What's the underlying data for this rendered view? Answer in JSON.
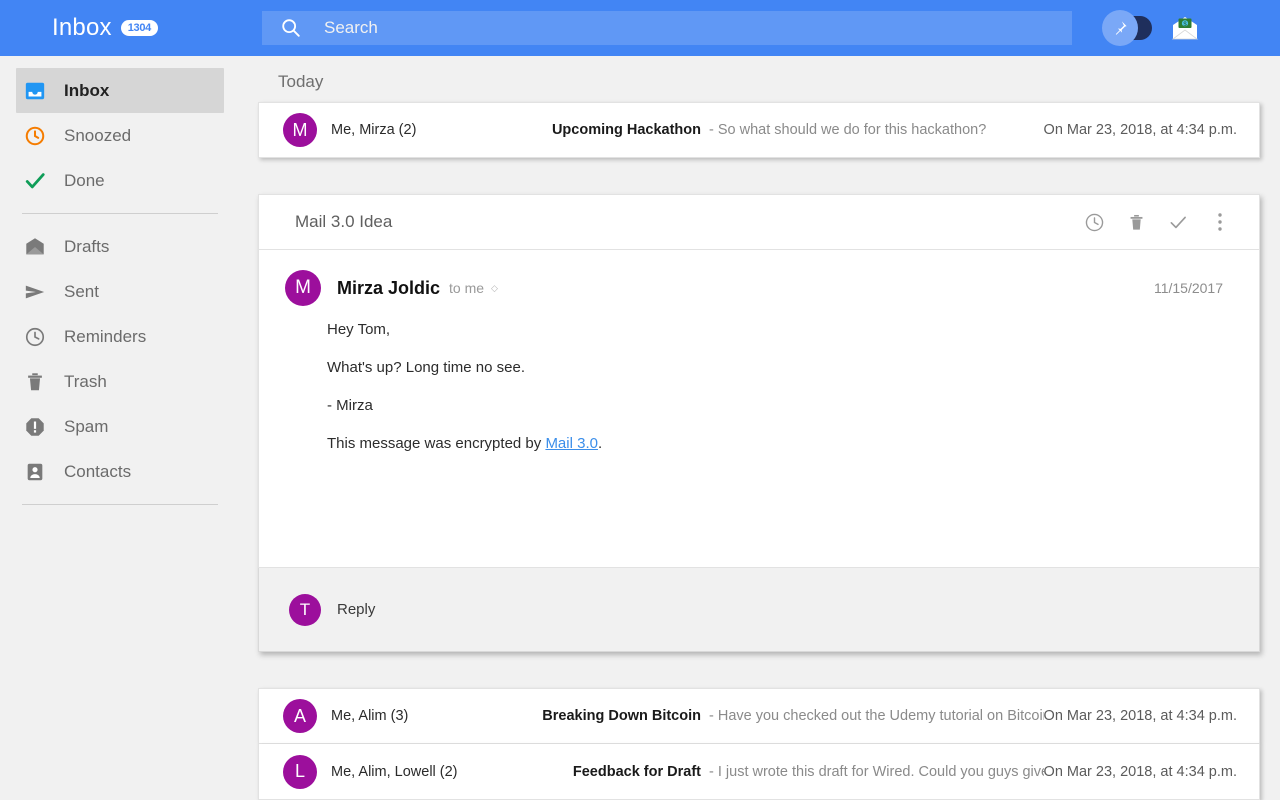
{
  "topbar": {
    "title": "Inbox",
    "badge": "1304",
    "search_placeholder": "Search",
    "search_value": "",
    "search_icon": "search-icon",
    "pin_toggle": {
      "icon": "pin-icon",
      "state": "on"
    },
    "mail_money_icon": "open-envelope-money-icon"
  },
  "sidebar": {
    "items": [
      {
        "label": "Inbox",
        "icon": "inbox-icon",
        "active": true
      },
      {
        "label": "Snoozed",
        "icon": "clock-icon",
        "active": false
      },
      {
        "label": "Done",
        "icon": "check-icon",
        "active": false
      },
      {
        "label": "Drafts",
        "icon": "envelope-icon",
        "active": false
      },
      {
        "label": "Sent",
        "icon": "send-icon",
        "active": false
      },
      {
        "label": "Reminders",
        "icon": "clock-outline-icon",
        "active": false
      },
      {
        "label": "Trash",
        "icon": "trash-icon",
        "active": false
      },
      {
        "label": "Spam",
        "icon": "alert-icon",
        "active": false
      },
      {
        "label": "Contacts",
        "icon": "person-icon",
        "active": false
      }
    ]
  },
  "main": {
    "section_label": "Today",
    "top_row": {
      "avatar": "M",
      "people": "Me, Mirza (2)",
      "subject": "Upcoming Hackathon",
      "snippet": "- So what should we do for this hackathon?",
      "date": "On Mar 23, 2018, at 4:34 p.m."
    },
    "thread": {
      "title": "Mail 3.0 Idea",
      "actions": [
        {
          "name": "snooze-icon",
          "glyph": "clock"
        },
        {
          "name": "trash-icon",
          "glyph": "trash"
        },
        {
          "name": "done-icon",
          "glyph": "check"
        },
        {
          "name": "more-icon",
          "glyph": "dots"
        }
      ],
      "message": {
        "avatar": "M",
        "sender": "Mirza Joldic",
        "to": "to me",
        "date": "11/15/2017",
        "lines": [
          "Hey Tom,",
          "What's up? Long time no see.",
          "- Mirza"
        ],
        "footer_prefix": "This message was encrypted by ",
        "footer_link": "Mail 3.0",
        "footer_suffix": "."
      },
      "reply": {
        "avatar": "T",
        "label": "Reply"
      }
    },
    "bottom_rows": [
      {
        "avatar": "A",
        "people": "Me, Alim (3)",
        "subject": "Breaking Down Bitcoin",
        "snippet": "- Have you checked out the Udemy tutorial on Bitcoin that I'm developing?",
        "date": "On Mar 23, 2018, at 4:34 p.m."
      },
      {
        "avatar": "L",
        "people": "Me, Alim, Lowell (2)",
        "subject": "Feedback for Draft",
        "snippet": "- I just wrote this draft for Wired. Could you guys give a look over and let me know?",
        "date": "On Mar 23, 2018, at 4:34 p.m."
      }
    ]
  },
  "colors": {
    "brand_blue": "#4285f4",
    "search_blue": "#6098f5",
    "avatar_purple": "#9c0f9c",
    "link_blue": "#3b8eea",
    "snoozed_orange": "#f57c00",
    "done_green": "#0f9d58",
    "sidebar_bg": "#f1f1f1"
  }
}
